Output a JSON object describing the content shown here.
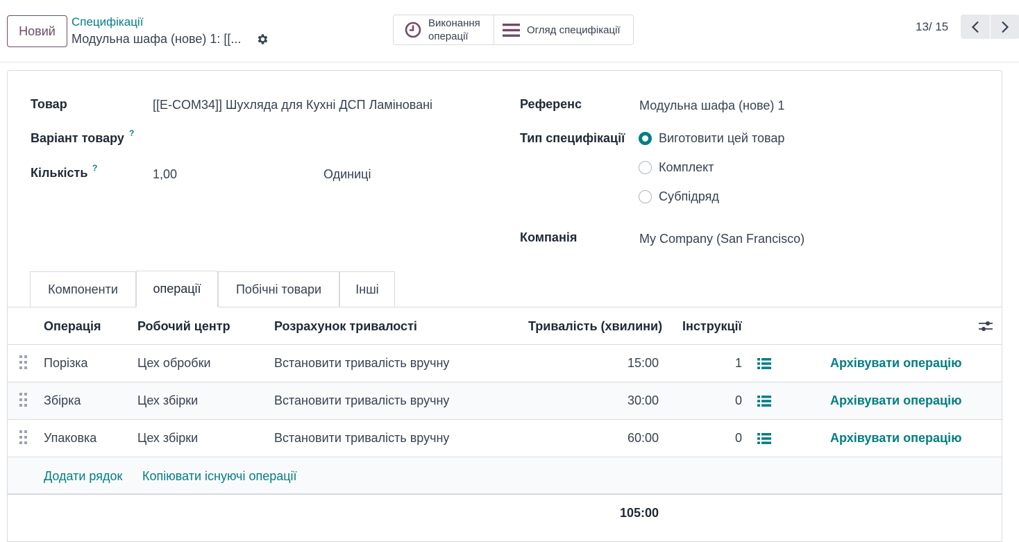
{
  "control_panel": {
    "new_button": "Новий",
    "breadcrumb": "Специфікації",
    "record_title": "Модульна шафа (нове) 1: [[...",
    "gear_icon": "gear-icon",
    "smart_buttons": {
      "operations_label": "Виконання\nоперації",
      "operations_icon": "clock-icon",
      "bom_overview_label": "Огляд специфікації",
      "bom_overview_icon": "bars-icon"
    },
    "pager": {
      "value": "13/ 15"
    }
  },
  "form": {
    "product": {
      "label": "Товар",
      "value": "[[E-COM34]] Шухляда для Кухні ДСП Ламіновані"
    },
    "variant": {
      "label": "Варіант товару",
      "help": "?",
      "value": ""
    },
    "quantity": {
      "label": "Кількість",
      "help": "?",
      "value": "1,00",
      "uom": "Одиниці"
    },
    "reference": {
      "label": "Референс",
      "value": "Модульна шафа (нове) 1"
    },
    "bom_type": {
      "label": "Тип специфікації",
      "options": [
        "Виготовити цей товар",
        "Комплект",
        "Субпідряд"
      ],
      "selected": "Виготовити цей товар"
    },
    "company": {
      "label": "Компанія",
      "value": "My Company (San Francisco)"
    }
  },
  "tabs": [
    "Компоненти",
    "операції",
    "Побічні товари",
    "Інші"
  ],
  "active_tab": "операції",
  "operations_table": {
    "headers": {
      "operation": "Операція",
      "workcenter": "Робочий центр",
      "duration_computation": "Розрахунок тривалості",
      "duration": "Тривалість (хвилини)",
      "instructions": "Інструкції"
    },
    "rows": [
      {
        "operation": "Порізка",
        "workcenter": "Цех обробки",
        "duration_computation": "Встановити тривалість вручну",
        "duration": "15:00",
        "instructions": "1",
        "action": "Архівувати операцію"
      },
      {
        "operation": "Збірка",
        "workcenter": "Цех збірки",
        "duration_computation": "Встановити тривалість вручну",
        "duration": "30:00",
        "instructions": "0",
        "action": "Архівувати операцію"
      },
      {
        "operation": "Упаковка",
        "workcenter": "Цех збірки",
        "duration_computation": "Встановити тривалість вручну",
        "duration": "60:00",
        "instructions": "0",
        "action": "Архівувати операцію"
      }
    ],
    "add_line": "Додати рядок",
    "copy_operations": "Копіювати існуючі операції",
    "total_duration": "105:00"
  },
  "colors": {
    "brand": "#714B67",
    "link": "#017e84",
    "border": "#d8dadd"
  }
}
